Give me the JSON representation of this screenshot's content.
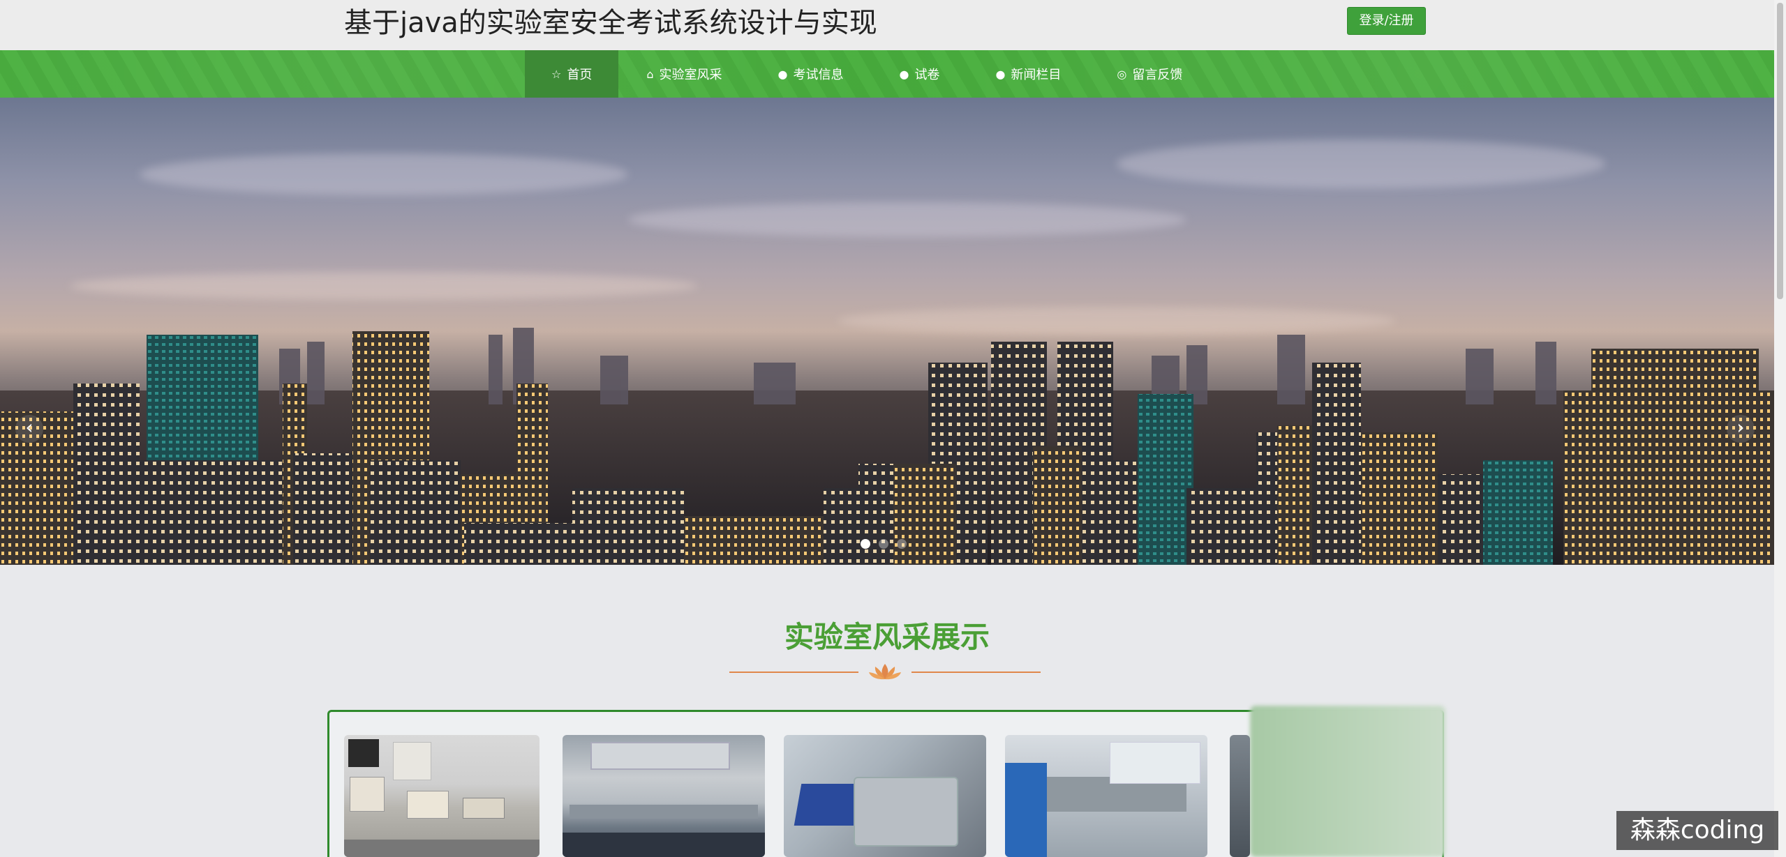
{
  "header": {
    "site_title": "基于java的实验室安全考试系统设计与实现",
    "login_label": "登录/注册"
  },
  "nav": {
    "items": [
      {
        "icon": "star-icon",
        "glyph": "☆",
        "label": "首页",
        "active": true
      },
      {
        "icon": "bag-icon",
        "glyph": "⌂",
        "label": "实验室风采"
      },
      {
        "icon": "info-icon",
        "glyph": "●",
        "label": "考试信息"
      },
      {
        "icon": "question-icon",
        "glyph": "●",
        "label": "试卷"
      },
      {
        "icon": "info-icon",
        "glyph": "●",
        "label": "新闻栏目"
      },
      {
        "icon": "globe-icon",
        "glyph": "◎",
        "label": "留言反馈"
      }
    ]
  },
  "banner": {
    "prev_glyph": "‹",
    "next_glyph": "›",
    "slide_count": 3,
    "active_slide": 1
  },
  "section": {
    "title": "实验室风采展示"
  },
  "colors": {
    "brand_green": "#3fa13b",
    "nav_green": "#4bb040",
    "title_green": "#4a9f35",
    "divider_orange": "#e0874b"
  },
  "watermark": "森森coding"
}
